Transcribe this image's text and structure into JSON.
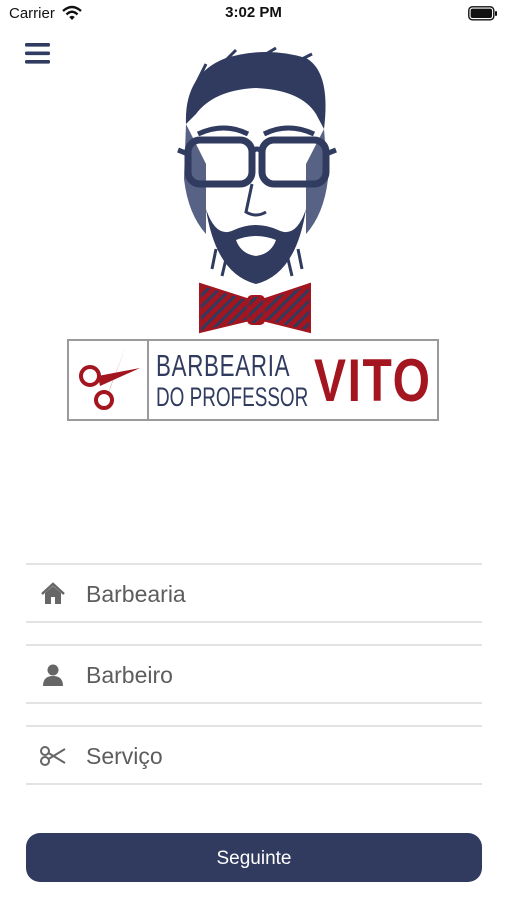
{
  "status_bar": {
    "carrier": "Carrier",
    "time": "3:02 PM"
  },
  "menu": {
    "icon": "hamburger-menu-icon"
  },
  "logo": {
    "line1": "BARBEARIA",
    "line2": "DO PROFESSOR",
    "brand": "VITO",
    "colors": {
      "navy": "#303b5f",
      "red": "#a3151f"
    }
  },
  "form": {
    "barbearia": {
      "placeholder": "Barbearia",
      "icon": "home-icon"
    },
    "barbeiro": {
      "placeholder": "Barbeiro",
      "icon": "user-icon"
    },
    "servico": {
      "placeholder": "Serviço",
      "icon": "scissors-icon"
    }
  },
  "next_button": {
    "label": "Seguinte",
    "color": "#303b5f"
  }
}
